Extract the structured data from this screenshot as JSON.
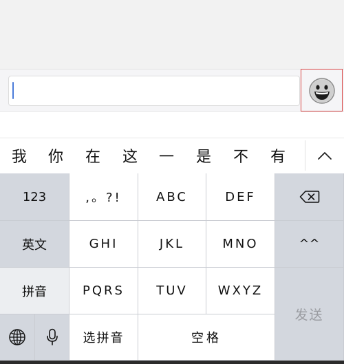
{
  "input": {
    "placeholder": "",
    "value": ""
  },
  "emoji_button": {
    "icon": "smiley-face-icon"
  },
  "candidates": [
    "我",
    "你",
    "在",
    "这",
    "一",
    "是",
    "不",
    "有"
  ],
  "expand_icon": "chevron-up-icon",
  "keyboard": {
    "row1": {
      "numbers": "123",
      "punct": ",。?!",
      "abc": "ABC",
      "def": "DEF",
      "delete_icon": "backspace-icon"
    },
    "row2": {
      "english": "英文",
      "ghi": "GHI",
      "jkl": "JKL",
      "mno": "MNO",
      "emoticon": "^^"
    },
    "row3": {
      "pinyin": "拼音",
      "pqrs": "PQRS",
      "tuv": "TUV",
      "wxyz": "WXYZ"
    },
    "row4": {
      "globe_icon": "globe-icon",
      "mic_icon": "microphone-icon",
      "select_pinyin": "选拼音",
      "space": "空格"
    },
    "send": "发送"
  },
  "colors": {
    "accent_caret": "#4a7bd9",
    "highlight_border": "#d94444",
    "key_white": "#ffffff",
    "key_gray": "#d3d7de"
  }
}
